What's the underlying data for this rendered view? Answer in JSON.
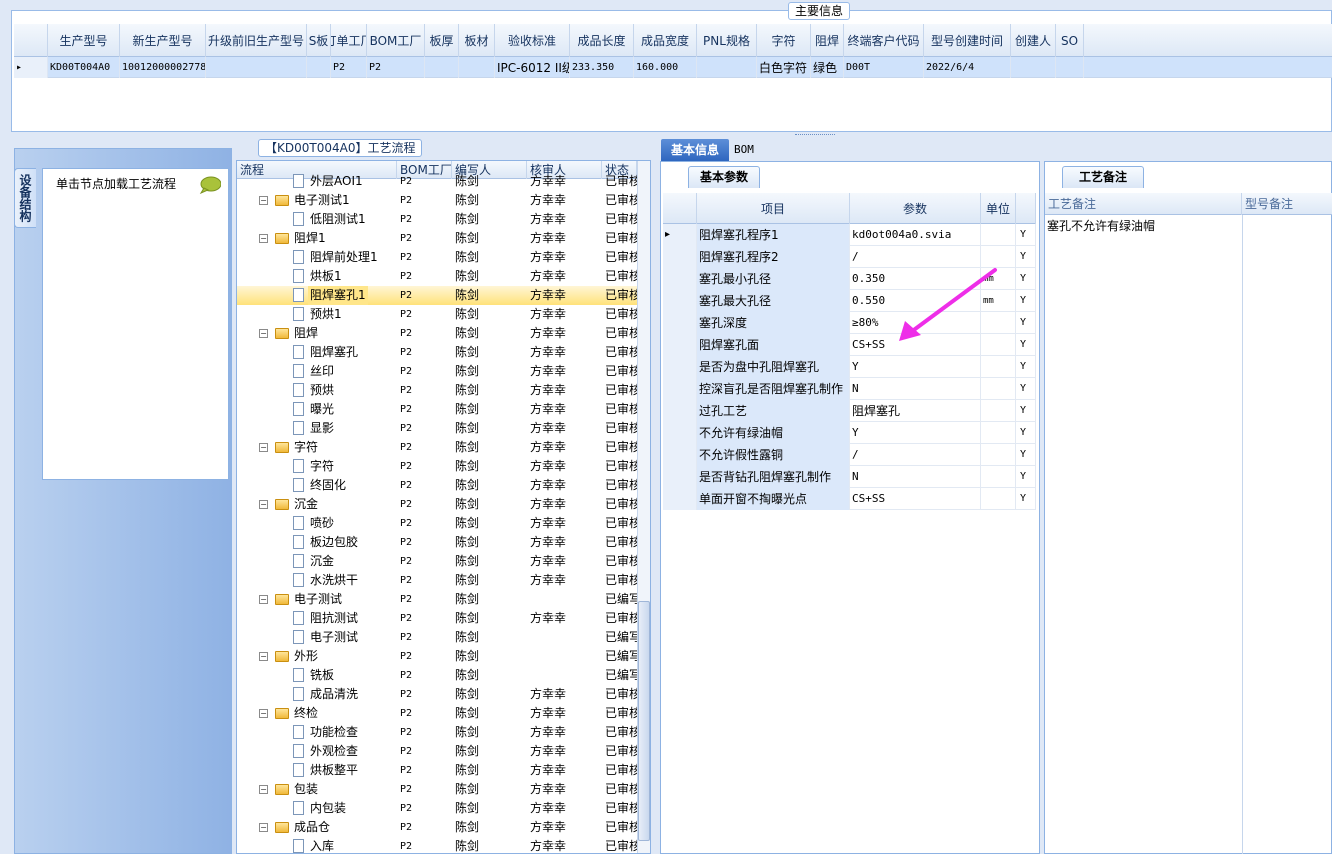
{
  "top": {
    "legend": "主要信息",
    "columns": [
      "生产型号",
      "新生产型号",
      "升级前旧生产型号",
      "S板",
      "订单工厂",
      "BOM工厂",
      "板厚",
      "板材",
      "验收标准",
      "成品长度",
      "成品宽度",
      "PNL规格",
      "字符",
      "阻焊",
      "终端客户代码",
      "型号创建时间",
      "创建人",
      "SO"
    ],
    "row": [
      "KD00T004A0",
      "10012000002778",
      "",
      "",
      "P2",
      "P2",
      "",
      "",
      "IPC-6012 II级",
      "233.350",
      "160.000",
      "",
      "白色字符",
      "绿色",
      "D00T",
      "2022/6/4",
      "",
      ""
    ],
    "row_marker": "▸"
  },
  "left": {
    "side_tab": "设备结构",
    "flow_hint": "单击节点加载工艺流程"
  },
  "tree": {
    "title": "【KD00T004A0】工艺流程",
    "headers": [
      "流程",
      "BOM工厂",
      "编写人",
      "核审人",
      "状态"
    ],
    "rows": [
      {
        "name": "外层AOI1",
        "bom": "P2",
        "auth": "陈剑",
        "rev": "方幸幸",
        "stat": "已审核",
        "lvl": 1,
        "kind": "doc"
      },
      {
        "name": "电子测试1",
        "bom": "P2",
        "auth": "陈剑",
        "rev": "方幸幸",
        "stat": "已审核",
        "lvl": 0,
        "kind": "folder"
      },
      {
        "name": "低阻测试1",
        "bom": "P2",
        "auth": "陈剑",
        "rev": "方幸幸",
        "stat": "已审核",
        "lvl": 1,
        "kind": "doc"
      },
      {
        "name": "阻焊1",
        "bom": "P2",
        "auth": "陈剑",
        "rev": "方幸幸",
        "stat": "已审核",
        "lvl": 0,
        "kind": "folder"
      },
      {
        "name": "阻焊前处理1",
        "bom": "P2",
        "auth": "陈剑",
        "rev": "方幸幸",
        "stat": "已审核",
        "lvl": 1,
        "kind": "doc"
      },
      {
        "name": "烘板1",
        "bom": "P2",
        "auth": "陈剑",
        "rev": "方幸幸",
        "stat": "已审核",
        "lvl": 1,
        "kind": "doc"
      },
      {
        "name": "阻焊塞孔1",
        "bom": "P2",
        "auth": "陈剑",
        "rev": "方幸幸",
        "stat": "已审核",
        "lvl": 1,
        "kind": "doc",
        "sel": true
      },
      {
        "name": "预烘1",
        "bom": "P2",
        "auth": "陈剑",
        "rev": "方幸幸",
        "stat": "已审核",
        "lvl": 1,
        "kind": "doc"
      },
      {
        "name": "阻焊",
        "bom": "P2",
        "auth": "陈剑",
        "rev": "方幸幸",
        "stat": "已审核",
        "lvl": 0,
        "kind": "folder"
      },
      {
        "name": "阻焊塞孔",
        "bom": "P2",
        "auth": "陈剑",
        "rev": "方幸幸",
        "stat": "已审核",
        "lvl": 1,
        "kind": "doc"
      },
      {
        "name": "丝印",
        "bom": "P2",
        "auth": "陈剑",
        "rev": "方幸幸",
        "stat": "已审核",
        "lvl": 1,
        "kind": "doc"
      },
      {
        "name": "预烘",
        "bom": "P2",
        "auth": "陈剑",
        "rev": "方幸幸",
        "stat": "已审核",
        "lvl": 1,
        "kind": "doc"
      },
      {
        "name": "曝光",
        "bom": "P2",
        "auth": "陈剑",
        "rev": "方幸幸",
        "stat": "已审核",
        "lvl": 1,
        "kind": "doc"
      },
      {
        "name": "显影",
        "bom": "P2",
        "auth": "陈剑",
        "rev": "方幸幸",
        "stat": "已审核",
        "lvl": 1,
        "kind": "doc"
      },
      {
        "name": "字符",
        "bom": "P2",
        "auth": "陈剑",
        "rev": "方幸幸",
        "stat": "已审核",
        "lvl": 0,
        "kind": "folder"
      },
      {
        "name": "字符",
        "bom": "P2",
        "auth": "陈剑",
        "rev": "方幸幸",
        "stat": "已审核",
        "lvl": 1,
        "kind": "doc"
      },
      {
        "name": "终固化",
        "bom": "P2",
        "auth": "陈剑",
        "rev": "方幸幸",
        "stat": "已审核",
        "lvl": 1,
        "kind": "doc"
      },
      {
        "name": "沉金",
        "bom": "P2",
        "auth": "陈剑",
        "rev": "方幸幸",
        "stat": "已审核",
        "lvl": 0,
        "kind": "folder"
      },
      {
        "name": "喷砂",
        "bom": "P2",
        "auth": "陈剑",
        "rev": "方幸幸",
        "stat": "已审核",
        "lvl": 1,
        "kind": "doc"
      },
      {
        "name": "板边包胶",
        "bom": "P2",
        "auth": "陈剑",
        "rev": "方幸幸",
        "stat": "已审核",
        "lvl": 1,
        "kind": "doc"
      },
      {
        "name": "沉金",
        "bom": "P2",
        "auth": "陈剑",
        "rev": "方幸幸",
        "stat": "已审核",
        "lvl": 1,
        "kind": "doc"
      },
      {
        "name": "水洗烘干",
        "bom": "P2",
        "auth": "陈剑",
        "rev": "方幸幸",
        "stat": "已审核",
        "lvl": 1,
        "kind": "doc"
      },
      {
        "name": "电子测试",
        "bom": "P2",
        "auth": "陈剑",
        "rev": "",
        "stat": "已编写",
        "lvl": 0,
        "kind": "folder"
      },
      {
        "name": "阻抗测试",
        "bom": "P2",
        "auth": "陈剑",
        "rev": "方幸幸",
        "stat": "已审核",
        "lvl": 1,
        "kind": "doc"
      },
      {
        "name": "电子测试",
        "bom": "P2",
        "auth": "陈剑",
        "rev": "",
        "stat": "已编写",
        "lvl": 1,
        "kind": "doc"
      },
      {
        "name": "外形",
        "bom": "P2",
        "auth": "陈剑",
        "rev": "",
        "stat": "已编写",
        "lvl": 0,
        "kind": "folder"
      },
      {
        "name": "铣板",
        "bom": "P2",
        "auth": "陈剑",
        "rev": "",
        "stat": "已编写",
        "lvl": 1,
        "kind": "doc"
      },
      {
        "name": "成品清洗",
        "bom": "P2",
        "auth": "陈剑",
        "rev": "方幸幸",
        "stat": "已审核",
        "lvl": 1,
        "kind": "doc"
      },
      {
        "name": "终检",
        "bom": "P2",
        "auth": "陈剑",
        "rev": "方幸幸",
        "stat": "已审核",
        "lvl": 0,
        "kind": "folder"
      },
      {
        "name": "功能检查",
        "bom": "P2",
        "auth": "陈剑",
        "rev": "方幸幸",
        "stat": "已审核",
        "lvl": 1,
        "kind": "doc"
      },
      {
        "name": "外观检查",
        "bom": "P2",
        "auth": "陈剑",
        "rev": "方幸幸",
        "stat": "已审核",
        "lvl": 1,
        "kind": "doc"
      },
      {
        "name": "烘板整平",
        "bom": "P2",
        "auth": "陈剑",
        "rev": "方幸幸",
        "stat": "已审核",
        "lvl": 1,
        "kind": "doc"
      },
      {
        "name": "包装",
        "bom": "P2",
        "auth": "陈剑",
        "rev": "方幸幸",
        "stat": "已审核",
        "lvl": 0,
        "kind": "folder"
      },
      {
        "name": "内包装",
        "bom": "P2",
        "auth": "陈剑",
        "rev": "方幸幸",
        "stat": "已审核",
        "lvl": 1,
        "kind": "doc"
      },
      {
        "name": "成品仓",
        "bom": "P2",
        "auth": "陈剑",
        "rev": "方幸幸",
        "stat": "已审核",
        "lvl": 0,
        "kind": "folder"
      },
      {
        "name": "入库",
        "bom": "P2",
        "auth": "陈剑",
        "rev": "方幸幸",
        "stat": "已审核",
        "lvl": 1,
        "kind": "doc"
      }
    ]
  },
  "basic": {
    "tab_basic": "基本信息",
    "tab_bom": "BOM",
    "subtab": "基本参数",
    "headers": [
      "项目",
      "参数",
      "单位"
    ],
    "rows": [
      {
        "item": "阻焊塞孔程序1",
        "param": "kd0ot004a0.svia",
        "unit": "",
        "flag": "Y",
        "cur": true
      },
      {
        "item": "阻焊塞孔程序2",
        "param": "/",
        "unit": "",
        "flag": "Y"
      },
      {
        "item": "塞孔最小孔径",
        "param": "0.350",
        "unit": "mm",
        "flag": "Y"
      },
      {
        "item": "塞孔最大孔径",
        "param": "0.550",
        "unit": "mm",
        "flag": "Y"
      },
      {
        "item": "塞孔深度",
        "param": "≥80%",
        "unit": "",
        "flag": "Y"
      },
      {
        "item": "阻焊塞孔面",
        "param": "CS+SS",
        "unit": "",
        "flag": "Y"
      },
      {
        "item": "是否为盘中孔阻焊塞孔",
        "param": "Y",
        "unit": "",
        "flag": "Y"
      },
      {
        "item": "控深盲孔是否阻焊塞孔制作",
        "param": "N",
        "unit": "",
        "flag": "Y"
      },
      {
        "item": "过孔工艺",
        "param": "阻焊塞孔",
        "unit": "",
        "flag": "Y",
        "cn": true
      },
      {
        "item": "不允许有绿油帽",
        "param": "Y",
        "unit": "",
        "flag": "Y"
      },
      {
        "item": "不允许假性露铜",
        "param": "/",
        "unit": "",
        "flag": "Y"
      },
      {
        "item": "是否背钻孔阻焊塞孔制作",
        "param": "N",
        "unit": "",
        "flag": "Y"
      },
      {
        "item": "单面开窗不掏曝光点",
        "param": "CS+SS",
        "unit": "",
        "flag": "Y"
      }
    ]
  },
  "remark": {
    "subtab": "工艺备注",
    "headers": [
      "工艺备注",
      "型号备注"
    ],
    "text": "塞孔不允许有绿油帽"
  },
  "colors": {
    "selection": "#ffe27a",
    "accent": "#2e66bf",
    "arrow": "#ee2ee8"
  }
}
